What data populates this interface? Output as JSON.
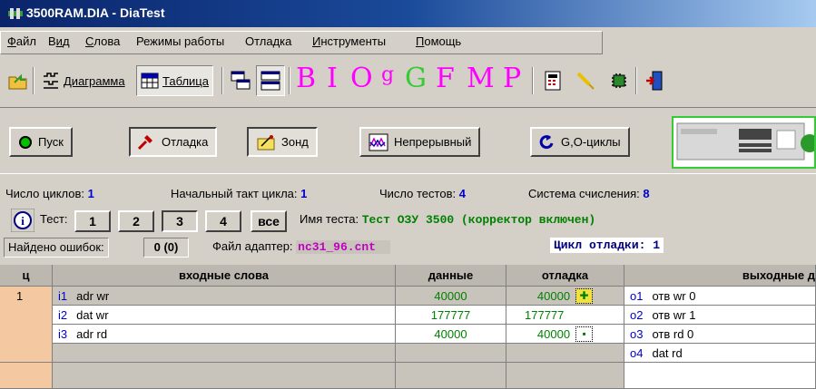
{
  "window": {
    "title": "3500RAM.DIA - DiaTest"
  },
  "menu": [
    {
      "label": "Файл",
      "ul": "Ф",
      "rest": "айл"
    },
    {
      "label": "Вид",
      "pre": "В",
      "ul": "и",
      "rest": "д"
    },
    {
      "label": "Слова",
      "ul": "С",
      "rest": "лова"
    },
    {
      "label": "Режимы работы"
    },
    {
      "label": "Отладка"
    },
    {
      "label": "Инструменты",
      "ul": "И",
      "rest": "нструменты"
    },
    {
      "label": "Помощь",
      "ul": "П",
      "rest": "омощь"
    }
  ],
  "toolbar": {
    "diagram_label": "Диаграмма",
    "table_label": "Таблица",
    "letters": [
      {
        "text": "B",
        "color": "#ff00ff"
      },
      {
        "text": "I",
        "color": "#ff00ff"
      },
      {
        "text": "O",
        "color": "#ff00ff"
      },
      {
        "text": "g",
        "color": "#ff00ff"
      },
      {
        "text": "G",
        "color": "#33cc33"
      },
      {
        "text": "F",
        "color": "#ff00ff"
      },
      {
        "text": "M",
        "color": "#ff00ff"
      },
      {
        "text": "P",
        "color": "#ff00ff"
      }
    ]
  },
  "actions": {
    "run": "Пуск",
    "debug": "Отладка",
    "probe": "Зонд",
    "continuous": "Непрерывный",
    "go_cycles": "G,O-циклы"
  },
  "info": {
    "cycles_label": "Число циклов:",
    "cycles_value": "1",
    "start_tact_label": "Начальный такт цикла:",
    "start_tact_value": "1",
    "tests_label": "Число тестов:",
    "tests_value": "4",
    "radix_label": "Система счисления:",
    "radix_value": "8",
    "test_label": "Тест:",
    "test_buttons": [
      "1",
      "2",
      "3",
      "4",
      "все"
    ],
    "test_name_label": "Имя теста:",
    "test_name_value": "Тест ОЗУ 3500 (корректор включен)",
    "errors_label": "Найдено ошибок:",
    "errors_value": "0 (0)",
    "adapter_label": "Файл адаптер:",
    "adapter_value": "nc31_96.cnt",
    "debug_cycle": "Цикл отладки: 1"
  },
  "table": {
    "headers": {
      "cycle": "ц",
      "input_words": "входные слова",
      "data": "данные",
      "debug": "отладка",
      "output_words": "выходные д"
    },
    "row_number": "1",
    "rows": [
      {
        "in_idx": "i1",
        "in_name": "adr wr",
        "data": "40000",
        "debug": "40000",
        "out_idx": "o1",
        "out_name": "отв wr 0"
      },
      {
        "in_idx": "i2",
        "in_name": "dat wr",
        "data": "177777",
        "debug": "177777",
        "out_idx": "o2",
        "out_name": "отв wr 1"
      },
      {
        "in_idx": "i3",
        "in_name": "adr rd",
        "data": "40000",
        "debug": "40000",
        "out_idx": "o3",
        "out_name": "отв rd 0"
      },
      {
        "in_idx": "",
        "in_name": "",
        "data": "",
        "debug": "",
        "out_idx": "o4",
        "out_name": "dat rd"
      }
    ]
  }
}
